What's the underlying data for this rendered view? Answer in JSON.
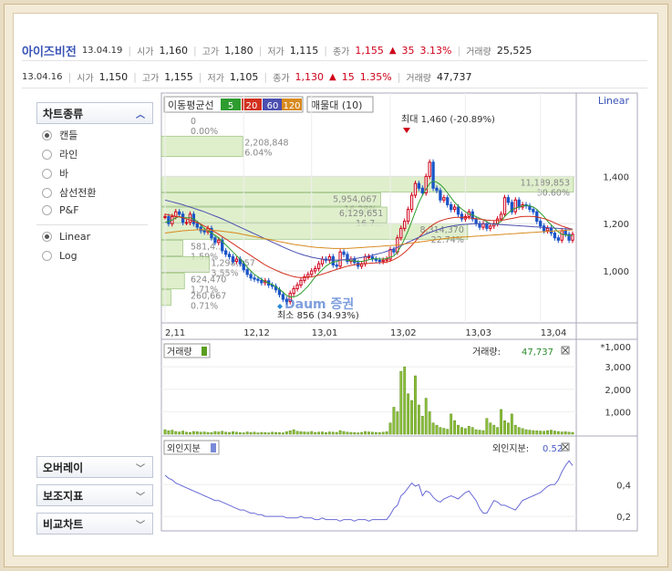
{
  "quote_main": {
    "name": "아이즈비전",
    "date": "13.04.19",
    "open_label": "시가",
    "open": "1,160",
    "high_label": "고가",
    "high": "1,180",
    "low_label": "저가",
    "low": "1,115",
    "close_label": "종가",
    "close": "1,155",
    "change": "35",
    "change_pct": "3.13%",
    "volume_label": "거래량",
    "volume": "25,525"
  },
  "quote_prev": {
    "date": "13.04.16",
    "open_label": "시가",
    "open": "1,150",
    "high_label": "고가",
    "high": "1,155",
    "low_label": "저가",
    "low": "1,105",
    "close_label": "종가",
    "close": "1,130",
    "change": "15",
    "change_pct": "1.35%",
    "volume_label": "거래량",
    "volume": "47,737"
  },
  "sidebar": {
    "chart_type_label": "차트종류",
    "chart_types": [
      {
        "label": "캔들",
        "selected": true
      },
      {
        "label": "라인",
        "selected": false
      },
      {
        "label": "바",
        "selected": false
      },
      {
        "label": "삼선전환",
        "selected": false
      },
      {
        "label": "P&F",
        "selected": false
      }
    ],
    "scales": [
      {
        "label": "Linear",
        "selected": true
      },
      {
        "label": "Log",
        "selected": false
      }
    ],
    "buttons": [
      "오버레이",
      "보조지표",
      "비교차트"
    ]
  },
  "toolbar": {
    "ma_label": "이동평균선",
    "ma_periods": [
      {
        "label": "5",
        "color": "#2e9c2e"
      },
      {
        "label": "20",
        "color": "#d2301e"
      },
      {
        "label": "60",
        "color": "#4b4fb0"
      },
      {
        "label": "120",
        "color": "#d88a1e"
      }
    ],
    "volume_profile_label": "매물대 (10)"
  },
  "price_panel": {
    "scale_label": "Linear",
    "max_annotation": "최대 1,460 (-20.89%)",
    "min_annotation": "최소 856 (34.93%)",
    "watermark": "Daum 증권",
    "profile_labels": [
      {
        "value": "0",
        "pct": "0.00%"
      },
      {
        "value": "2,208,848",
        "pct": "6.04%"
      },
      {
        "value": "11,189,853",
        "pct": "30.60%"
      },
      {
        "value": "5,954,067",
        "pct": "16.28%"
      },
      {
        "value": "6,129,651",
        "pct": "16.7..."
      },
      {
        "value": "8,314,370",
        "pct": "22.74%"
      },
      {
        "value": "581,4..",
        "pct": "1.59%"
      },
      {
        "value": "1,298,957",
        "pct": "3.55%"
      },
      {
        "value": "624,470",
        "pct": "1.71%"
      },
      {
        "value": "260,667",
        "pct": "0.71%"
      }
    ]
  },
  "volume_panel": {
    "title": "거래량",
    "value_label": "거래량:",
    "value": "47,737",
    "unit_label": "*1,000"
  },
  "foreign_panel": {
    "title": "외인지분",
    "value_label": "외인지분:",
    "value": "0.52"
  },
  "chart_data": {
    "type": "candlestick",
    "x_ticks": [
      "2,11",
      "12,12",
      "13,01",
      "13,02",
      "13,03",
      "13,04"
    ],
    "price_axis": {
      "ticks": [
        1000,
        1200,
        1400
      ],
      "ylim": [
        780,
        1660
      ]
    },
    "volume_axis": {
      "ticks": [
        1000,
        2000,
        3000
      ],
      "ylim": [
        0,
        3250
      ]
    },
    "foreign_axis": {
      "ticks": [
        0.2,
        0.4
      ],
      "ylim": [
        0.12,
        0.58
      ]
    },
    "price_close": [
      1230,
      1200,
      1230,
      1250,
      1240,
      1205,
      1205,
      1240,
      1200,
      1185,
      1170,
      1165,
      1180,
      1140,
      1120,
      1130,
      1085,
      1070,
      1060,
      1040,
      1050,
      1030,
      1005,
      985,
      970,
      965,
      960,
      950,
      958,
      940,
      935,
      920,
      900,
      880,
      870,
      905,
      925,
      940,
      960,
      975,
      985,
      1000,
      1010,
      1030,
      1050,
      1045,
      1060,
      1025,
      1020,
      1080,
      1070,
      1040,
      1050,
      1035,
      1020,
      1030,
      1060,
      1060,
      1050,
      1045,
      1040,
      1045,
      1050,
      1090,
      1080,
      1140,
      1180,
      1210,
      1260,
      1320,
      1370,
      1350,
      1330,
      1400,
      1460,
      1350,
      1340,
      1300,
      1310,
      1280,
      1260,
      1270,
      1240,
      1220,
      1230,
      1250,
      1220,
      1200,
      1185,
      1200,
      1180,
      1190,
      1200,
      1220,
      1240,
      1310,
      1290,
      1250,
      1300,
      1270,
      1280,
      1275,
      1260,
      1250,
      1210,
      1190,
      1170,
      1180,
      1160,
      1140,
      1130,
      1170,
      1155,
      1130,
      1155
    ],
    "ma5": [
      1205,
      1210,
      1215,
      1225,
      1230,
      1225,
      1225,
      1225,
      1220,
      1210,
      1195,
      1180,
      1170,
      1160,
      1150,
      1140,
      1125,
      1110,
      1095,
      1080,
      1065,
      1050,
      1035,
      1015,
      1000,
      985,
      975,
      965,
      955,
      948,
      942,
      933,
      922,
      910,
      896,
      890,
      890,
      895,
      905,
      920,
      935,
      955,
      975,
      990,
      1005,
      1020,
      1030,
      1038,
      1040,
      1045,
      1047,
      1045,
      1043,
      1042,
      1040,
      1040,
      1043,
      1047,
      1050,
      1052,
      1050,
      1050,
      1052,
      1058,
      1063,
      1080,
      1105,
      1135,
      1170,
      1210,
      1250,
      1290,
      1320,
      1345,
      1370,
      1380,
      1375,
      1365,
      1350,
      1330,
      1310,
      1290,
      1275,
      1262,
      1250,
      1240,
      1236,
      1230,
      1222,
      1216,
      1208,
      1200,
      1198,
      1200,
      1210,
      1230,
      1245,
      1258,
      1265,
      1270,
      1275,
      1278,
      1275,
      1270,
      1260,
      1245,
      1230,
      1210,
      1195,
      1180,
      1165,
      1155,
      1152,
      1150,
      1150
    ],
    "ma20": [
      1240,
      1237,
      1234,
      1231,
      1228,
      1225,
      1220,
      1215,
      1210,
      1205,
      1198,
      1190,
      1182,
      1173,
      1164,
      1155,
      1145,
      1135,
      1125,
      1115,
      1105,
      1095,
      1085,
      1075,
      1065,
      1055,
      1045,
      1035,
      1025,
      1017,
      1010,
      1003,
      996,
      990,
      985,
      980,
      976,
      973,
      972,
      972,
      973,
      975,
      978,
      982,
      986,
      991,
      996,
      1001,
      1006,
      1011,
      1016,
      1020,
      1023,
      1026,
      1028,
      1030,
      1031,
      1032,
      1033,
      1034,
      1035,
      1036,
      1038,
      1042,
      1048,
      1056,
      1066,
      1078,
      1092,
      1108,
      1125,
      1142,
      1158,
      1172,
      1185,
      1196,
      1205,
      1212,
      1217,
      1221,
      1224,
      1226,
      1227,
      1227,
      1226,
      1225,
      1223,
      1221,
      1219,
      1217,
      1215,
      1214,
      1213,
      1213,
      1214,
      1216,
      1219,
      1222,
      1225,
      1228,
      1230,
      1231,
      1231,
      1230,
      1228,
      1225,
      1221,
      1216,
      1210,
      1203,
      1196,
      1190,
      1185,
      1180,
      1176
    ],
    "ma60": [
      1300,
      1296,
      1292,
      1288,
      1284,
      1280,
      1275,
      1270,
      1265,
      1260,
      1255,
      1250,
      1244,
      1238,
      1232,
      1226,
      1220,
      1213,
      1206,
      1199,
      1192,
      1185,
      1178,
      1171,
      1164,
      1157,
      1150,
      1143,
      1136,
      1129,
      1122,
      1115,
      1108,
      1101,
      1094,
      1088,
      1082,
      1076,
      1071,
      1066,
      1062,
      1058,
      1055,
      1052,
      1050,
      1048,
      1047,
      1046,
      1046,
      1046,
      1047,
      1048,
      1050,
      1052,
      1054,
      1057,
      1060,
      1063,
      1066,
      1070,
      1074,
      1078,
      1083,
      1088,
      1094,
      1100,
      1107,
      1114,
      1121,
      1128,
      1135,
      1142,
      1149,
      1156,
      1162,
      1168,
      1173,
      1178,
      1182,
      1186,
      1189,
      1192,
      1194,
      1196,
      1197,
      1198,
      1199,
      1200,
      1200,
      1200,
      1200,
      1199,
      1198,
      1197,
      1196,
      1195,
      1194,
      1193,
      1192,
      1191,
      1190,
      1189,
      1188,
      1187,
      1186,
      1185,
      1184,
      1183,
      1182,
      1181,
      1180,
      1179,
      1178,
      1177,
      1176
    ],
    "ma120": [
      1160,
      1162,
      1164,
      1166,
      1168,
      1170,
      1171,
      1172,
      1173,
      1174,
      1174,
      1174,
      1173,
      1172,
      1171,
      1170,
      1168,
      1166,
      1164,
      1162,
      1160,
      1157,
      1154,
      1151,
      1148,
      1145,
      1142,
      1139,
      1136,
      1133,
      1130,
      1127,
      1124,
      1121,
      1118,
      1115,
      1112,
      1110,
      1108,
      1106,
      1104,
      1102,
      1100,
      1099,
      1098,
      1097,
      1096,
      1095,
      1095,
      1095,
      1095,
      1095,
      1096,
      1097,
      1098,
      1099,
      1100,
      1101,
      1102,
      1103,
      1104,
      1105,
      1106,
      1107,
      1108,
      1110,
      1112,
      1114,
      1116,
      1118,
      1120,
      1122,
      1124,
      1126,
      1128,
      1130,
      1132,
      1134,
      1136,
      1138,
      1140,
      1141,
      1142,
      1143,
      1144,
      1145,
      1146,
      1147,
      1148,
      1149,
      1150,
      1151,
      1152,
      1153,
      1154,
      1155,
      1156,
      1157,
      1158,
      1159,
      1160,
      1161,
      1162,
      1163,
      1164,
      1165,
      1166,
      1167,
      1168,
      1169,
      1170,
      1171,
      1172,
      1173,
      1174
    ],
    "volume": [
      200,
      150,
      180,
      120,
      100,
      140,
      90,
      80,
      120,
      110,
      90,
      100,
      80,
      70,
      120,
      100,
      130,
      90,
      80,
      110,
      90,
      70,
      60,
      100,
      80,
      90,
      60,
      80,
      70,
      60,
      90,
      80,
      70,
      60,
      110,
      150,
      200,
      130,
      110,
      100,
      90,
      120,
      80,
      90,
      100,
      70,
      100,
      90,
      80,
      160,
      120,
      90,
      80,
      70,
      60,
      80,
      120,
      100,
      90,
      80,
      70,
      90,
      110,
      500,
      1200,
      1000,
      2800,
      3000,
      1800,
      1500,
      2600,
      1300,
      800,
      1600,
      1000,
      500,
      400,
      300,
      260,
      220,
      900,
      600,
      400,
      300,
      250,
      350,
      300,
      200,
      180,
      160,
      700,
      500,
      400,
      300,
      1100,
      600,
      500,
      900,
      400,
      300,
      250,
      200,
      180,
      160,
      150,
      140,
      130,
      160,
      180,
      140,
      120,
      100,
      110,
      90,
      80
    ],
    "foreign": [
      0.46,
      0.44,
      0.43,
      0.41,
      0.4,
      0.39,
      0.38,
      0.37,
      0.36,
      0.35,
      0.34,
      0.33,
      0.32,
      0.31,
      0.3,
      0.3,
      0.29,
      0.28,
      0.27,
      0.26,
      0.25,
      0.24,
      0.24,
      0.23,
      0.22,
      0.22,
      0.21,
      0.21,
      0.2,
      0.2,
      0.2,
      0.2,
      0.2,
      0.2,
      0.19,
      0.19,
      0.19,
      0.19,
      0.2,
      0.19,
      0.19,
      0.19,
      0.18,
      0.18,
      0.19,
      0.18,
      0.18,
      0.18,
      0.18,
      0.17,
      0.18,
      0.18,
      0.18,
      0.17,
      0.18,
      0.18,
      0.18,
      0.17,
      0.18,
      0.18,
      0.18,
      0.18,
      0.18,
      0.21,
      0.25,
      0.27,
      0.33,
      0.35,
      0.38,
      0.41,
      0.39,
      0.4,
      0.33,
      0.36,
      0.35,
      0.32,
      0.3,
      0.29,
      0.31,
      0.32,
      0.33,
      0.32,
      0.31,
      0.33,
      0.35,
      0.36,
      0.33,
      0.3,
      0.25,
      0.22,
      0.22,
      0.26,
      0.3,
      0.29,
      0.27,
      0.27,
      0.26,
      0.25,
      0.24,
      0.27,
      0.3,
      0.31,
      0.32,
      0.33,
      0.34,
      0.35,
      0.37,
      0.39,
      0.4,
      0.4,
      0.43,
      0.48,
      0.52,
      0.55,
      0.52
    ]
  }
}
